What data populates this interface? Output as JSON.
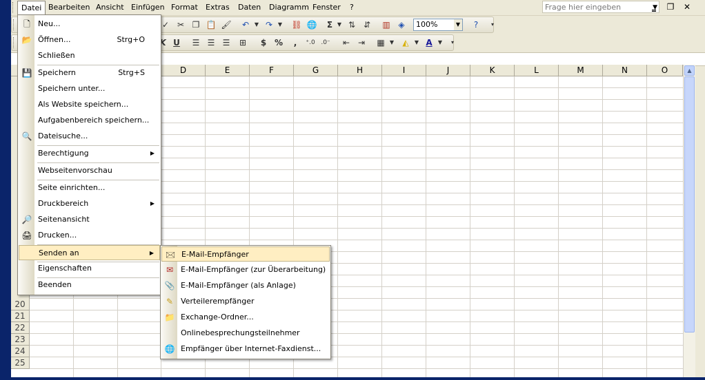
{
  "menubar": {
    "items": [
      "Datei",
      "Bearbeiten",
      "Ansicht",
      "Einfügen",
      "Format",
      "Extras",
      "Daten",
      "Diagramm",
      "Fenster",
      "?"
    ],
    "help_placeholder": "Frage hier eingeben"
  },
  "toolbar": {
    "zoom": "100%",
    "currency_label": "$",
    "percent_label": "%"
  },
  "sheet": {
    "columns": [
      "D",
      "E",
      "F",
      "G",
      "H",
      "I",
      "J",
      "K",
      "L",
      "M",
      "N",
      "O"
    ],
    "rows": [
      "20",
      "21",
      "22",
      "23",
      "24",
      "25"
    ]
  },
  "file_menu": {
    "items": [
      {
        "label": "Neu...",
        "shortcut": ""
      },
      {
        "label": "Öffnen...",
        "shortcut": "Strg+O"
      },
      {
        "label": "Schließen",
        "shortcut": ""
      },
      {
        "label": "Speichern",
        "shortcut": "Strg+S"
      },
      {
        "label": "Speichern unter...",
        "shortcut": ""
      },
      {
        "label": "Als Website speichern...",
        "shortcut": ""
      },
      {
        "label": "Aufgabenbereich speichern...",
        "shortcut": ""
      },
      {
        "label": "Dateisuche...",
        "shortcut": ""
      },
      {
        "label": "Berechtigung",
        "shortcut": ""
      },
      {
        "label": "Webseitenvorschau",
        "shortcut": ""
      },
      {
        "label": "Seite einrichten...",
        "shortcut": ""
      },
      {
        "label": "Druckbereich",
        "shortcut": ""
      },
      {
        "label": "Seitenansicht",
        "shortcut": ""
      },
      {
        "label": "Drucken...",
        "shortcut": ""
      },
      {
        "label": "Senden an",
        "shortcut": ""
      },
      {
        "label": "Eigenschaften",
        "shortcut": ""
      },
      {
        "label": "Beenden",
        "shortcut": ""
      }
    ]
  },
  "send_to_menu": {
    "items": [
      {
        "label": "E-Mail-Empfänger"
      },
      {
        "label": "E-Mail-Empfänger (zur Überarbeitung)"
      },
      {
        "label": "E-Mail-Empfänger (als Anlage)"
      },
      {
        "label": "Verteilerempfänger"
      },
      {
        "label": "Exchange-Ordner..."
      },
      {
        "label": "Onlinebesprechungsteilnehmer"
      },
      {
        "label": "Empfänger über Internet-Faxdienst..."
      }
    ]
  }
}
